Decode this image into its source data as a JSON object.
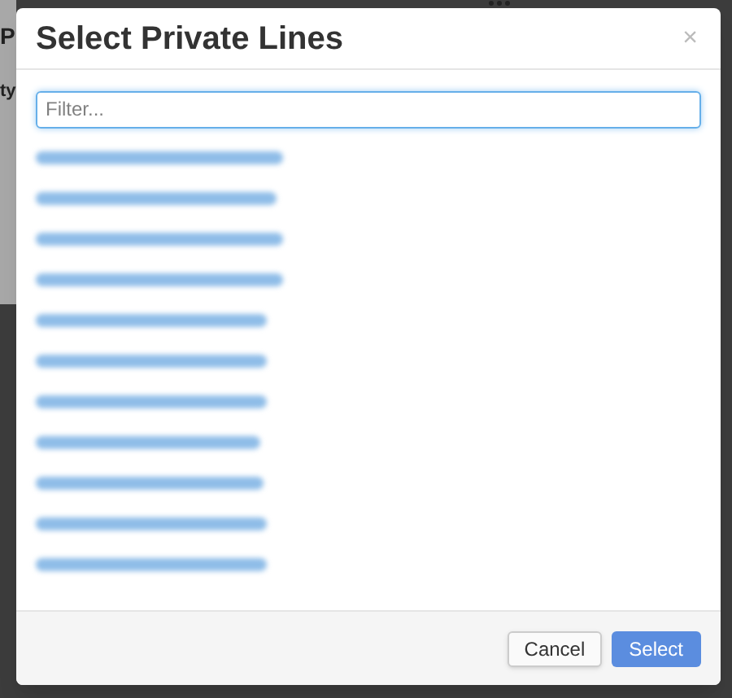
{
  "background_page": {
    "texts": [
      "P",
      "ty"
    ]
  },
  "dialog": {
    "title": "Select Private Lines",
    "close": "×",
    "filter": {
      "placeholder": "Filter..."
    },
    "lines": [
      {
        "kind": "redacted"
      },
      {
        "kind": "redacted"
      },
      {
        "kind": "redacted"
      },
      {
        "kind": "redacted"
      },
      {
        "kind": "redacted"
      },
      {
        "kind": "redacted"
      },
      {
        "kind": "redacted"
      },
      {
        "kind": "redacted"
      },
      {
        "kind": "redacted"
      },
      {
        "kind": "redacted"
      },
      {
        "kind": "redacted"
      }
    ],
    "buttons": [
      {
        "label": "Cancel",
        "kind": "default"
      },
      {
        "label": "Select",
        "kind": "primary"
      }
    ]
  }
}
